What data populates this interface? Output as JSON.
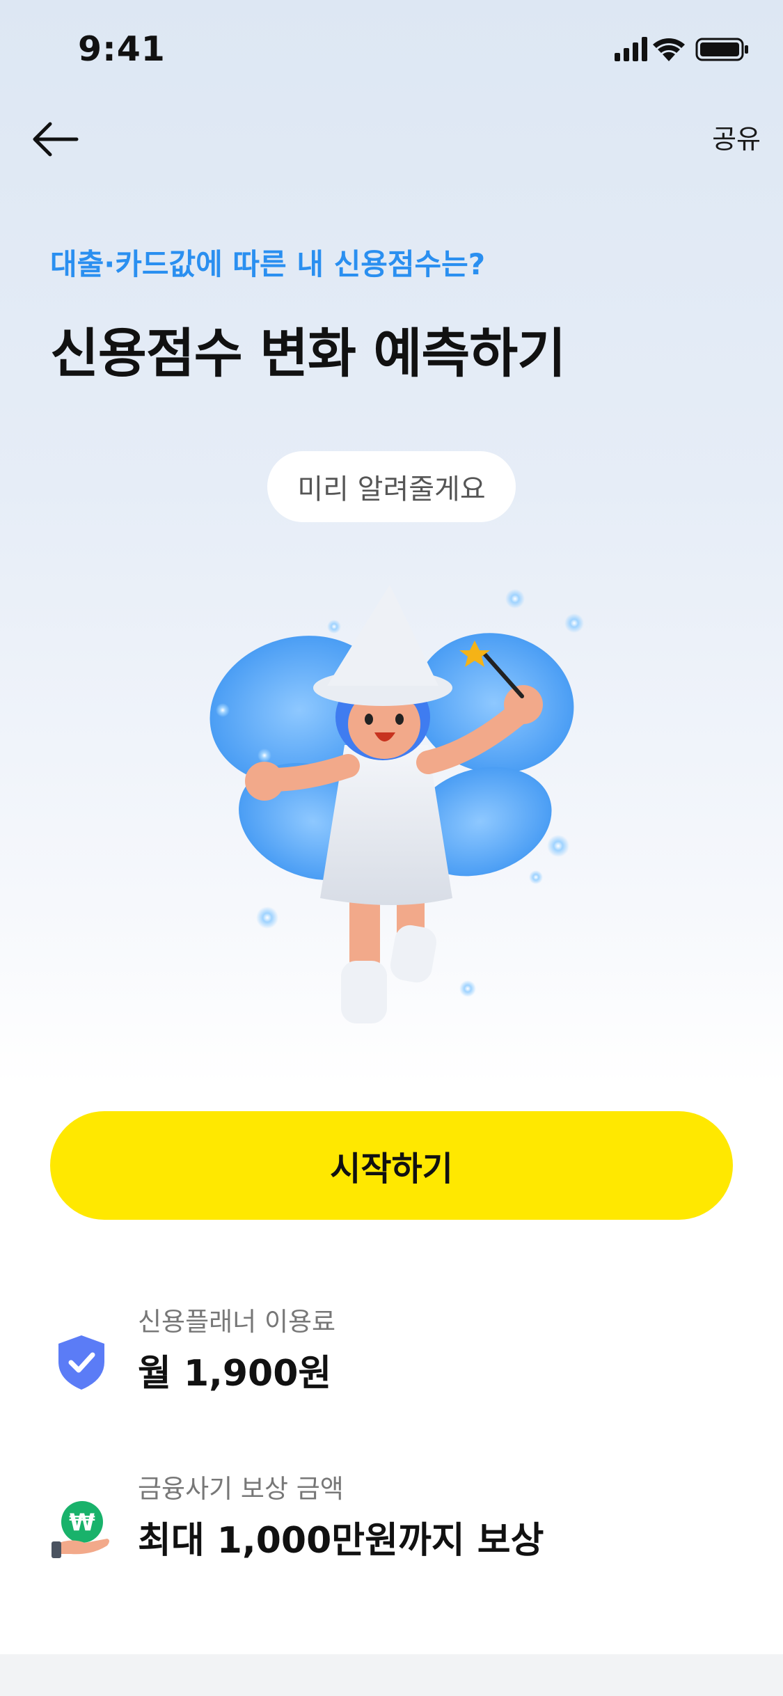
{
  "status_bar": {
    "time": "9:41"
  },
  "nav": {
    "share_label": "공유"
  },
  "header": {
    "subtitle": "대출·카드값에 따른 내 신용점수는?",
    "title": "신용점수 변화 예측하기",
    "pill_text": "미리 알려줄게요"
  },
  "cta": {
    "start_label": "시작하기"
  },
  "info": [
    {
      "label": "신용플래너 이용료",
      "value": "월 1,900원",
      "icon": "shield-check-icon"
    },
    {
      "label": "금융사기 보상 금액",
      "value": "최대 1,000만원까지 보상",
      "icon": "won-coin-hand-icon"
    }
  ],
  "colors": {
    "accent_blue": "#2a8ff0",
    "cta_yellow": "#ffe800",
    "shield_blue": "#5b7cf6",
    "coin_green": "#19b26b"
  }
}
